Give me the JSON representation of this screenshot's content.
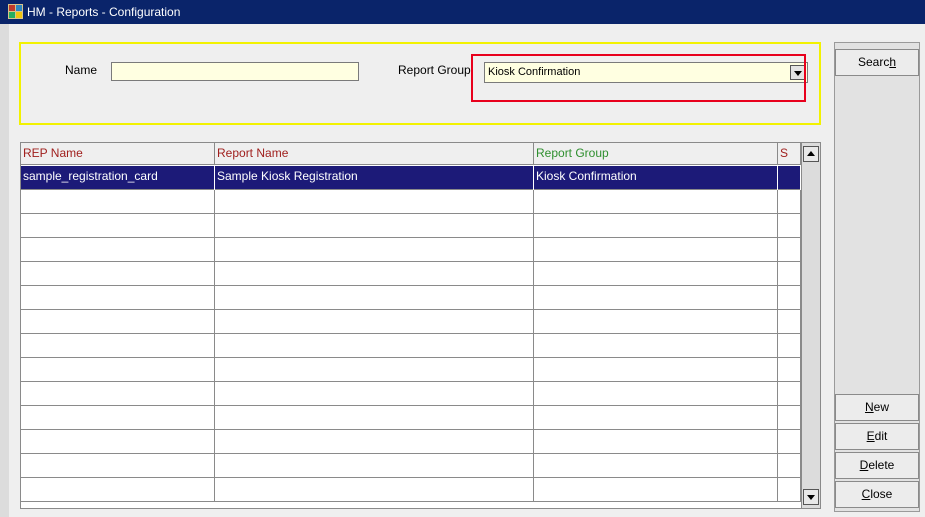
{
  "window": {
    "title": "HM - Reports - Configuration"
  },
  "search": {
    "name_label": "Name",
    "name_value": "",
    "group_label": "Report Group",
    "group_value": "Kiosk Confirmation"
  },
  "grid": {
    "columns": [
      "REP Name",
      "Report Name",
      "Report Group",
      "S"
    ],
    "column_colors": [
      "#a0201e",
      "#a0201e",
      "#2f8f2f",
      "#a0201e"
    ],
    "rows": [
      {
        "rep_name": "sample_registration_card",
        "report_name": "Sample Kiosk Registration",
        "report_group": "Kiosk Confirmation",
        "s": "",
        "selected": true
      },
      {
        "rep_name": "",
        "report_name": "",
        "report_group": "",
        "s": ""
      },
      {
        "rep_name": "",
        "report_name": "",
        "report_group": "",
        "s": ""
      },
      {
        "rep_name": "",
        "report_name": "",
        "report_group": "",
        "s": ""
      },
      {
        "rep_name": "",
        "report_name": "",
        "report_group": "",
        "s": ""
      },
      {
        "rep_name": "",
        "report_name": "",
        "report_group": "",
        "s": ""
      },
      {
        "rep_name": "",
        "report_name": "",
        "report_group": "",
        "s": ""
      },
      {
        "rep_name": "",
        "report_name": "",
        "report_group": "",
        "s": ""
      },
      {
        "rep_name": "",
        "report_name": "",
        "report_group": "",
        "s": ""
      },
      {
        "rep_name": "",
        "report_name": "",
        "report_group": "",
        "s": ""
      },
      {
        "rep_name": "",
        "report_name": "",
        "report_group": "",
        "s": ""
      },
      {
        "rep_name": "",
        "report_name": "",
        "report_group": "",
        "s": ""
      },
      {
        "rep_name": "",
        "report_name": "",
        "report_group": "",
        "s": ""
      },
      {
        "rep_name": "",
        "report_name": "",
        "report_group": "",
        "s": ""
      }
    ]
  },
  "buttons": {
    "search": {
      "label": "Search",
      "accel": "h"
    },
    "new": {
      "label": "New",
      "accel": "N"
    },
    "edit": {
      "label": "Edit",
      "accel": "E"
    },
    "delete": {
      "label": "Delete",
      "accel": "D"
    },
    "close": {
      "label": "Close",
      "accel": "C"
    }
  },
  "colors": {
    "titlebar": "#0a246a",
    "selected_row": "#1c1a78",
    "search_panel_border": "#f2f200",
    "highlight_border": "#e8001c",
    "input_background": "#ffffe1"
  },
  "icons": {
    "app": "app-icon",
    "dropdown": "chevron-down-icon",
    "scroll_up": "scroll-up-arrow-icon",
    "scroll_down": "scroll-down-arrow-icon"
  }
}
